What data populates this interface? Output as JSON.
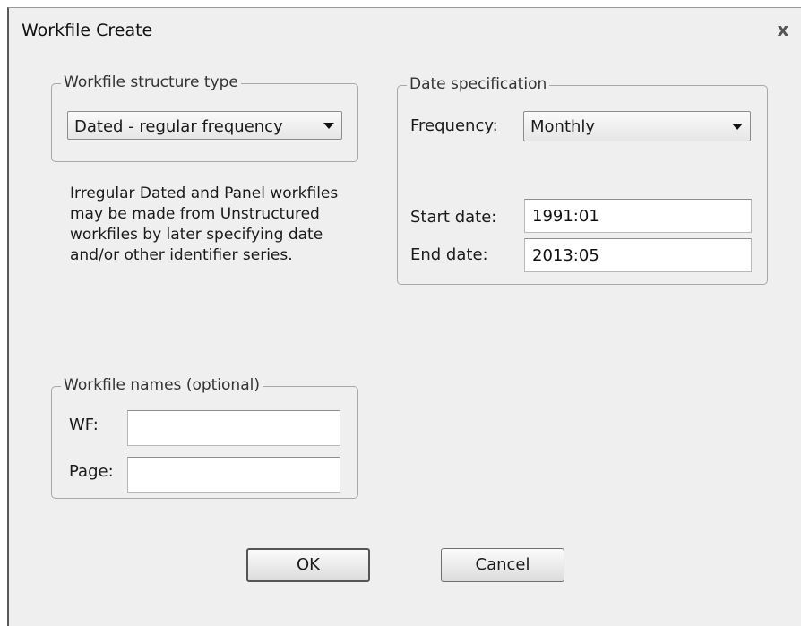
{
  "window": {
    "title": "Workfile Create",
    "close_glyph": "x"
  },
  "structure": {
    "legend": "Workfile structure type",
    "selected": "Dated - regular frequency"
  },
  "info_text": "Irregular Dated and Panel workfiles may be made from Unstructured workfiles by later specifying date and/or other identifier series.",
  "date_spec": {
    "legend": "Date specification",
    "frequency_label": "Frequency:",
    "frequency_value": "Monthly",
    "start_label": "Start date:",
    "start_value": "1991:01",
    "end_label": "End date:",
    "end_value": "2013:05"
  },
  "names": {
    "legend": "Workfile names (optional)",
    "wf_label": "WF:",
    "wf_value": "",
    "page_label": "Page:",
    "page_value": ""
  },
  "buttons": {
    "ok": "OK",
    "cancel": "Cancel"
  }
}
